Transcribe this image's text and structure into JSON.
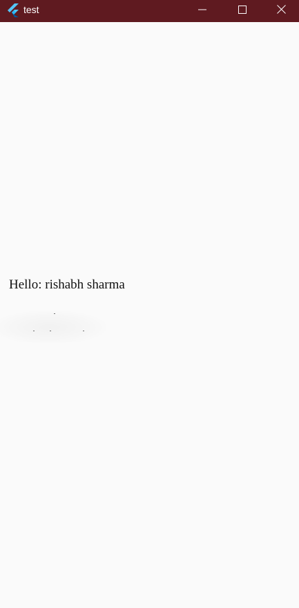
{
  "window": {
    "title": "test",
    "app_icon": "flutter-logo-icon",
    "controls": {
      "minimize_icon": "minimize-icon",
      "maximize_icon": "maximize-icon",
      "close_icon": "close-icon"
    },
    "titlebar_color": "#5f1a20"
  },
  "main": {
    "greeting": "Hello: rishabh sharma"
  }
}
